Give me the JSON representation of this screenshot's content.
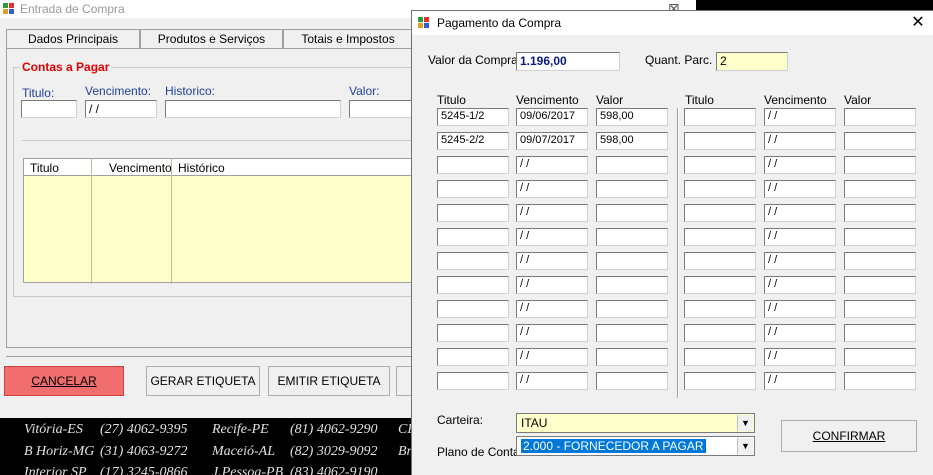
{
  "bg": {
    "title": "Entrada de Compra",
    "tabs": [
      "Dados Principais",
      "Produtos e Serviços",
      "Totais e Impostos"
    ],
    "group_label": "Contas a Pagar",
    "fields": {
      "titulo": "Titulo:",
      "vencimento": "Vencimento:",
      "historico": "Historico:",
      "valor": "Valor:",
      "venc_value": " / /"
    },
    "grid_headers": [
      "Titulo",
      "Vencimento",
      "Histórico"
    ],
    "buttons": {
      "cancelar": "CANCELAR",
      "gerar": "GERAR ETIQUETA",
      "emitir": "EMITIR ETIQUETA"
    },
    "close_glyph": "⊠"
  },
  "footer": {
    "row1": [
      "Vitória-ES",
      "(27) 4062-9395",
      "Recife-PE",
      "(81) 4062-9290",
      "CE"
    ],
    "row2": [
      "B Horiz-MG",
      "(31) 4063-9272",
      "Maceió-AL",
      "(82) 3029-9092",
      "Br"
    ],
    "row3": [
      "Interior SP",
      "(17) 3245-0866",
      "J.Pessoa-PB",
      "(83) 4062-9190",
      ""
    ]
  },
  "dialog": {
    "title": "Pagamento da Compra",
    "close": "✕",
    "valor_label": "Valor da Compra:",
    "valor_value": "1.196,00",
    "parc_label": "Quant. Parc.",
    "parc_value": "2",
    "headers_left": [
      "Titulo",
      "Vencimento",
      "Valor"
    ],
    "headers_right": [
      "Titulo",
      "Vencimento",
      "Valor"
    ],
    "rows_left": [
      [
        "5245-1/2",
        "09/06/2017",
        "598,00"
      ],
      [
        "5245-2/2",
        "09/07/2017",
        "598,00"
      ],
      [
        "",
        " / /",
        ""
      ],
      [
        "",
        " / /",
        ""
      ],
      [
        "",
        " / /",
        ""
      ],
      [
        "",
        " / /",
        ""
      ],
      [
        "",
        " / /",
        ""
      ],
      [
        "",
        " / /",
        ""
      ],
      [
        "",
        " / /",
        ""
      ],
      [
        "",
        " / /",
        ""
      ],
      [
        "",
        " / /",
        ""
      ],
      [
        "",
        " / /",
        ""
      ]
    ],
    "rows_right": [
      [
        "",
        " / /",
        ""
      ],
      [
        "",
        " / /",
        ""
      ],
      [
        "",
        " / /",
        ""
      ],
      [
        "",
        " / /",
        ""
      ],
      [
        "",
        " / /",
        ""
      ],
      [
        "",
        " / /",
        ""
      ],
      [
        "",
        " / /",
        ""
      ],
      [
        "",
        " / /",
        ""
      ],
      [
        "",
        " / /",
        ""
      ],
      [
        "",
        " / /",
        ""
      ],
      [
        "",
        " / /",
        ""
      ],
      [
        "",
        " / /",
        ""
      ]
    ],
    "carteira_label": "Carteira:",
    "carteira_value": "ITAU",
    "plano_label": "Plano de Conta:",
    "plano_value": "2.000 - FORNECEDOR A PAGAR",
    "confirmar": "CONFIRMAR"
  }
}
